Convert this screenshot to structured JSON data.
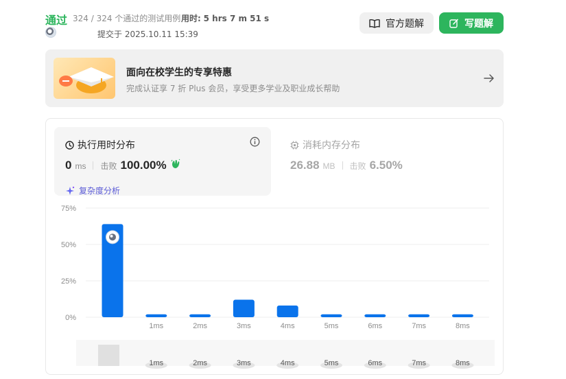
{
  "header": {
    "status": "通过",
    "cases": "324 / 324 个通过的测试用例",
    "runtime_label": "用时:",
    "runtime_value": "5 hrs 7 m 51 s",
    "submitted": "提交于 2025.10.11 15:39",
    "official_label": "官方题解",
    "write_label": "写题解"
  },
  "promo": {
    "title": "面向在校学生的专享特惠",
    "subtitle": "完成认证享 7 折 Plus 会员，享受更多学业及职业成长帮助"
  },
  "runtime_panel": {
    "title": "执行用时分布",
    "value": "0",
    "unit": "ms",
    "beats_label": "击败",
    "beats": "100.00%",
    "complexity": "复杂度分析"
  },
  "memory_panel": {
    "title": "消耗内存分布",
    "value": "26.88",
    "unit": "MB",
    "beats_label": "击败",
    "beats": "6.50%"
  },
  "colors": {
    "accent_green": "#2db55d",
    "bar_blue": "#0a73eb",
    "panel_bg": "#f5f5f5"
  },
  "chart_data": {
    "type": "bar",
    "categories": [
      "0ms",
      "1ms",
      "2ms",
      "3ms",
      "4ms",
      "5ms",
      "6ms",
      "7ms",
      "8ms"
    ],
    "tick_labels": [
      "",
      "1ms",
      "2ms",
      "3ms",
      "4ms",
      "5ms",
      "6ms",
      "7ms",
      "8ms"
    ],
    "values": [
      64,
      2,
      2,
      12,
      8,
      2,
      2,
      2,
      2
    ],
    "ylim": [
      0,
      75
    ],
    "yticks": [
      "0%",
      "25%",
      "50%",
      "75%"
    ],
    "yvalues": [
      0,
      25,
      50,
      75
    ],
    "grid": true,
    "highlight_index": 0,
    "minimap_labels": [
      "1ms",
      "2ms",
      "3ms",
      "4ms",
      "5ms",
      "6ms",
      "7ms",
      "8ms"
    ]
  }
}
